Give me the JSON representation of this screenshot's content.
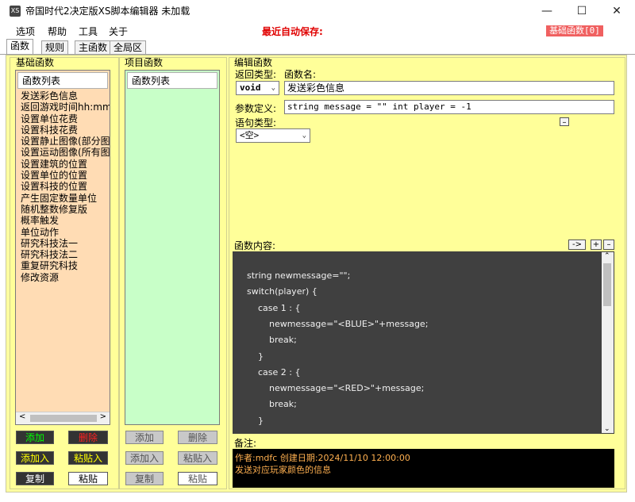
{
  "window": {
    "title": "帝国时代2决定版XS脚本编辑器 未加载",
    "app_icon": "XS",
    "minimize": "—",
    "maximize": "☐",
    "close": "✕"
  },
  "menu": {
    "items": [
      "选项",
      "帮助",
      "工具",
      "关于"
    ],
    "autosave_label": "最近自动保存:",
    "basefunc_badge": "基础函数[0]"
  },
  "tabs": [
    "函数",
    "规则",
    "主函数",
    "全局区"
  ],
  "base_functions": {
    "title": "基础函数",
    "list_header": "函数列表",
    "items": [
      "发送彩色信息",
      "返回游戏时间hh:mm:ss",
      "设置单位花费",
      "设置科技花费",
      "设置静止图像(部分图像",
      "设置运动图像(所有图像",
      "设置建筑的位置",
      "设置单位的位置",
      "设置科技的位置",
      "产生固定数量单位",
      "随机整数修复版",
      "概率触发",
      "单位动作",
      "研究科技法一",
      "研究科技法二",
      "重复研究科技",
      "修改资源"
    ],
    "buttons": {
      "add": "添加",
      "delete": "删除",
      "add_insert": "添加入",
      "paste_insert": "粘贴入",
      "copy": "复制",
      "paste": "粘贴"
    }
  },
  "project_functions": {
    "title": "项目函数",
    "list_header": "函数列表",
    "buttons": {
      "add": "添加",
      "delete": "删除",
      "add_insert": "添加入",
      "paste_insert": "粘贴入",
      "copy": "复制",
      "paste": "粘贴"
    }
  },
  "editor": {
    "title": "编辑函数",
    "return_type_label": "返回类型:",
    "return_type_value": "void",
    "func_name_label": "函数名:",
    "func_name_value": "发送彩色信息",
    "params_label": "参数定义:",
    "params_value": "string message = \"\" int player = -1",
    "stmt_type_label": "语句类型:",
    "stmt_type_value": "<空>",
    "collapse_btn": "–",
    "content_label": "函数内容:",
    "arrow_btn": "->",
    "plus_btn": "+",
    "minus_btn": "–",
    "code_lines": [
      "string newmessage=\"\";",
      "switch(player) {",
      "    case 1 : {",
      "        newmessage=\"<BLUE>\"+message;",
      "        break;",
      "    }",
      "    case 2 : {",
      "        newmessage=\"<RED>\"+message;",
      "        break;",
      "    }"
    ],
    "notes_label": "备注:",
    "notes_lines": [
      "作者:mdfc 创建日期:2024/11/10 12:00:00",
      "发送对应玩家颜色的信息"
    ]
  },
  "colors": {
    "panel_bg": "#ffff99",
    "base_list_bg": "#ffdcb4",
    "project_list_bg": "#c8ffc8",
    "add_text": "#00ff00",
    "delete_text": "#ff2020",
    "yellow_text": "#ffff00",
    "code_bg": "#404040",
    "notes_text": "#ffb050"
  }
}
